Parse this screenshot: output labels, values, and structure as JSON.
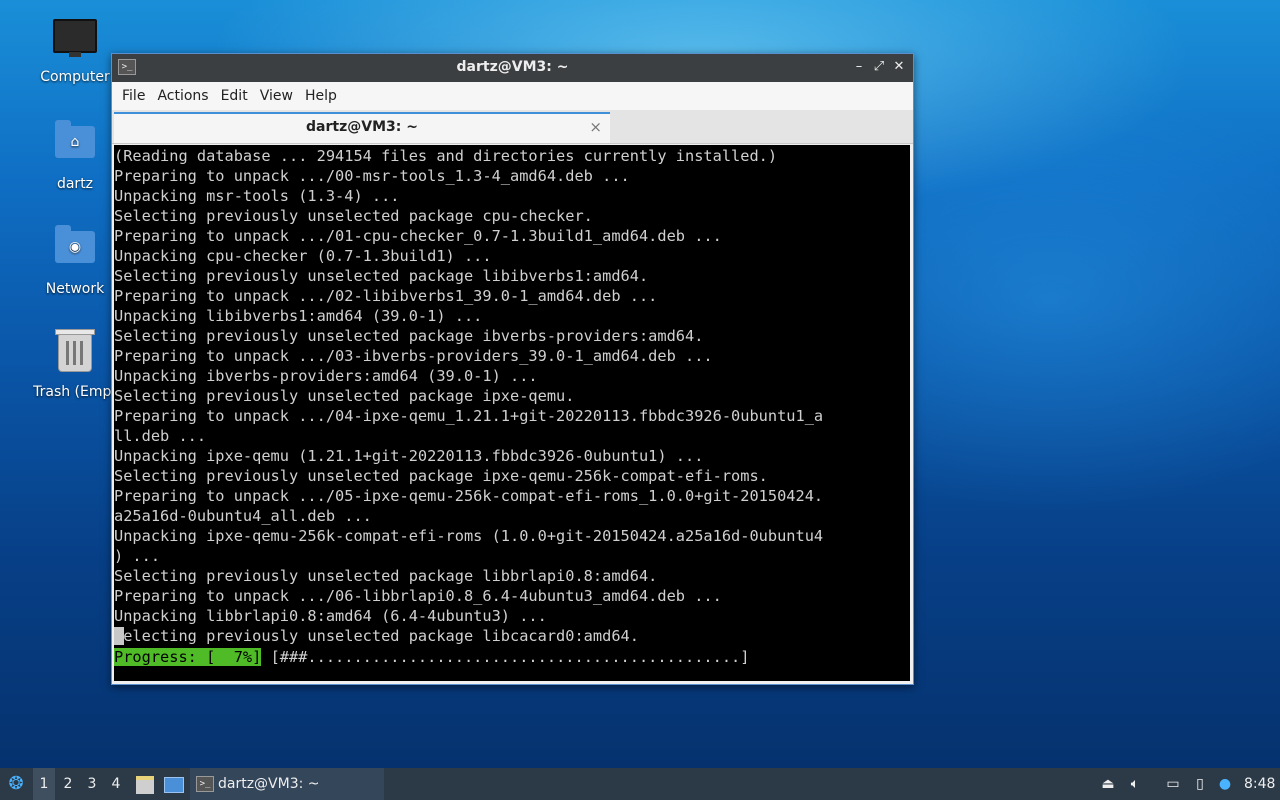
{
  "desktop": {
    "icons": [
      {
        "label": "Computer",
        "icon": "computer-icon"
      },
      {
        "label": "dartz",
        "icon": "home-folder-icon"
      },
      {
        "label": "Network",
        "icon": "network-folder-icon"
      },
      {
        "label": "Trash (Empt",
        "icon": "trash-icon"
      }
    ]
  },
  "window": {
    "title": "dartz@VM3: ~",
    "controls": {
      "minimize": "–",
      "maximize": "⤢",
      "close": "✕"
    },
    "menu": [
      "File",
      "Actions",
      "Edit",
      "View",
      "Help"
    ],
    "tab": {
      "label": "dartz@VM3: ~",
      "close": "×"
    },
    "terminal": {
      "lines": [
        "(Reading database ... 294154 files and directories currently installed.)",
        "Preparing to unpack .../00-msr-tools_1.3-4_amd64.deb ...",
        "Unpacking msr-tools (1.3-4) ...",
        "Selecting previously unselected package cpu-checker.",
        "Preparing to unpack .../01-cpu-checker_0.7-1.3build1_amd64.deb ...",
        "Unpacking cpu-checker (0.7-1.3build1) ...",
        "Selecting previously unselected package libibverbs1:amd64.",
        "Preparing to unpack .../02-libibverbs1_39.0-1_amd64.deb ...",
        "Unpacking libibverbs1:amd64 (39.0-1) ...",
        "Selecting previously unselected package ibverbs-providers:amd64.",
        "Preparing to unpack .../03-ibverbs-providers_39.0-1_amd64.deb ...",
        "Unpacking ibverbs-providers:amd64 (39.0-1) ...",
        "Selecting previously unselected package ipxe-qemu.",
        "Preparing to unpack .../04-ipxe-qemu_1.21.1+git-20220113.fbbdc3926-0ubuntu1_a",
        "ll.deb ...",
        "Unpacking ipxe-qemu (1.21.1+git-20220113.fbbdc3926-0ubuntu1) ...",
        "Selecting previously unselected package ipxe-qemu-256k-compat-efi-roms.",
        "Preparing to unpack .../05-ipxe-qemu-256k-compat-efi-roms_1.0.0+git-20150424.",
        "a25a16d-0ubuntu4_all.deb ...",
        "Unpacking ipxe-qemu-256k-compat-efi-roms (1.0.0+git-20150424.a25a16d-0ubuntu4",
        ") ...",
        "Selecting previously unselected package libbrlapi0.8:amd64.",
        "Preparing to unpack .../06-libbrlapi0.8_6.4-4ubuntu3_amd64.deb ...",
        "Unpacking libbrlapi0.8:amd64 (6.4-4ubuntu3) ...",
        "Selecting previously unselected package libcacard0:amd64."
      ],
      "progress_label": "Progress: [  7%]",
      "progress_bar": " [###...............................................]",
      "progress_percent": 7
    }
  },
  "taskbar": {
    "workspaces": [
      "1",
      "2",
      "3",
      "4"
    ],
    "active_workspace": "1",
    "task_label": "dartz@VM3: ~",
    "clock": "8:48"
  }
}
